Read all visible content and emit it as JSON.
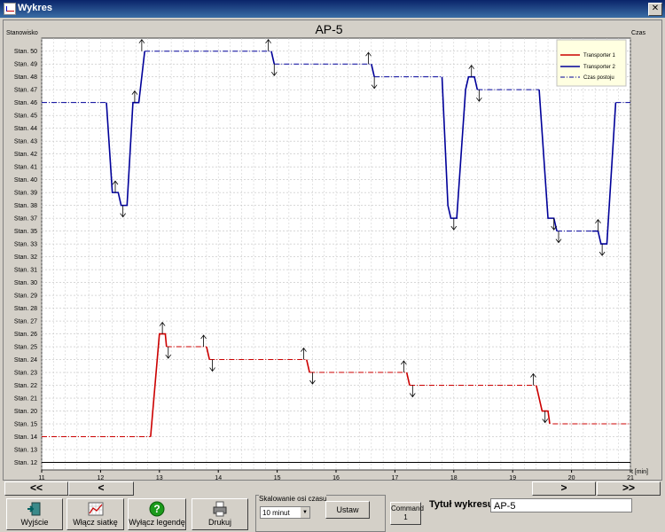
{
  "window": {
    "title": "Wykres"
  },
  "chart_data": {
    "type": "line",
    "title": "AP-5",
    "ylabel": "Stanowisko",
    "xlabel": "Czas",
    "x_unit": "t [min]",
    "xlim": [
      11,
      21
    ],
    "x_ticks": [
      "11",
      "12",
      "13",
      "14",
      "15",
      "16",
      "17",
      "18",
      "19",
      "20",
      "21"
    ],
    "y_categories": [
      "Stan. 12",
      "Stan. 13",
      "Stan. 14",
      "Stan. 15",
      "Stan. 20",
      "Stan. 21",
      "Stan. 22",
      "Stan. 23",
      "Stan. 24",
      "Stan. 25",
      "Stan. 26",
      "Stan. 27",
      "Stan. 28",
      "Stan. 29",
      "Stan. 30",
      "Stan. 31",
      "Stan. 32",
      "Stan. 33",
      "Stan. 35",
      "Stan. 37",
      "Stan. 38",
      "Stan. 39",
      "Stan. 40",
      "Stan. 41",
      "Stan. 42",
      "Stan. 43",
      "Stan. 44",
      "Stan. 45",
      "Stan. 46",
      "Stan. 47",
      "Stan. 48",
      "Stan. 49",
      "Stan. 50"
    ],
    "grid": true,
    "legend_position": "top-right",
    "legend": [
      {
        "label": "Transporter 1",
        "color": "#cc0000",
        "style": "solid"
      },
      {
        "label": "Transporter 2",
        "color": "#000099",
        "style": "solid"
      },
      {
        "label": "Czas postoju",
        "color": "#000099",
        "style": "dash-dot"
      }
    ],
    "series": [
      {
        "name": "Transporter 1",
        "color": "#cc0000",
        "segments": [
          {
            "kind": "idle",
            "points": [
              [
                11.0,
                "Stan. 14"
              ],
              [
                12.85,
                "Stan. 14"
              ]
            ]
          },
          {
            "kind": "move",
            "points": [
              [
                12.85,
                "Stan. 14"
              ],
              [
                13.0,
                "Stan. 26"
              ],
              [
                13.1,
                "Stan. 26"
              ],
              [
                13.12,
                "Stan. 25"
              ]
            ]
          },
          {
            "kind": "idle",
            "points": [
              [
                13.12,
                "Stan. 25"
              ],
              [
                13.8,
                "Stan. 25"
              ]
            ]
          },
          {
            "kind": "move",
            "points": [
              [
                13.8,
                "Stan. 25"
              ],
              [
                13.85,
                "Stan. 24"
              ]
            ]
          },
          {
            "kind": "idle",
            "points": [
              [
                13.85,
                "Stan. 24"
              ],
              [
                15.5,
                "Stan. 24"
              ]
            ]
          },
          {
            "kind": "move",
            "points": [
              [
                15.5,
                "Stan. 24"
              ],
              [
                15.55,
                "Stan. 23"
              ]
            ]
          },
          {
            "kind": "idle",
            "points": [
              [
                15.55,
                "Stan. 23"
              ],
              [
                17.2,
                "Stan. 23"
              ]
            ]
          },
          {
            "kind": "move",
            "points": [
              [
                17.2,
                "Stan. 23"
              ],
              [
                17.25,
                "Stan. 22"
              ]
            ]
          },
          {
            "kind": "idle",
            "points": [
              [
                17.25,
                "Stan. 22"
              ],
              [
                19.4,
                "Stan. 22"
              ]
            ]
          },
          {
            "kind": "move",
            "points": [
              [
                19.4,
                "Stan. 22"
              ],
              [
                19.5,
                "Stan. 20"
              ],
              [
                19.6,
                "Stan. 20"
              ],
              [
                19.63,
                "Stan. 15"
              ]
            ]
          },
          {
            "kind": "idle",
            "points": [
              [
                19.68,
                "Stan. 15"
              ],
              [
                21.0,
                "Stan. 15"
              ]
            ]
          }
        ],
        "markers": [
          {
            "x": 13.05,
            "y": "Stan. 26",
            "dir": "up"
          },
          {
            "x": 13.15,
            "y": "Stan. 25",
            "dir": "down"
          },
          {
            "x": 13.75,
            "y": "Stan. 25",
            "dir": "up"
          },
          {
            "x": 13.9,
            "y": "Stan. 24",
            "dir": "down"
          },
          {
            "x": 15.45,
            "y": "Stan. 24",
            "dir": "up"
          },
          {
            "x": 15.6,
            "y": "Stan. 23",
            "dir": "down"
          },
          {
            "x": 17.15,
            "y": "Stan. 23",
            "dir": "up"
          },
          {
            "x": 17.3,
            "y": "Stan. 22",
            "dir": "down"
          },
          {
            "x": 19.35,
            "y": "Stan. 22",
            "dir": "up"
          },
          {
            "x": 19.55,
            "y": "Stan. 20",
            "dir": "down"
          }
        ]
      },
      {
        "name": "Transporter 2",
        "color": "#000099",
        "segments": [
          {
            "kind": "idle",
            "points": [
              [
                11.0,
                "Stan. 46"
              ],
              [
                12.1,
                "Stan. 46"
              ]
            ]
          },
          {
            "kind": "move",
            "points": [
              [
                12.1,
                "Stan. 46"
              ],
              [
                12.2,
                "Stan. 39"
              ],
              [
                12.3,
                "Stan. 39"
              ],
              [
                12.35,
                "Stan. 38"
              ],
              [
                12.45,
                "Stan. 38"
              ],
              [
                12.55,
                "Stan. 46"
              ],
              [
                12.65,
                "Stan. 46"
              ],
              [
                12.75,
                "Stan. 50"
              ]
            ]
          },
          {
            "kind": "idle",
            "points": [
              [
                12.75,
                "Stan. 50"
              ],
              [
                14.9,
                "Stan. 50"
              ]
            ]
          },
          {
            "kind": "move",
            "points": [
              [
                14.9,
                "Stan. 50"
              ],
              [
                14.95,
                "Stan. 49"
              ]
            ]
          },
          {
            "kind": "idle",
            "points": [
              [
                14.95,
                "Stan. 49"
              ],
              [
                16.6,
                "Stan. 49"
              ]
            ]
          },
          {
            "kind": "move",
            "points": [
              [
                16.6,
                "Stan. 49"
              ],
              [
                16.65,
                "Stan. 48"
              ]
            ]
          },
          {
            "kind": "idle",
            "points": [
              [
                16.65,
                "Stan. 48"
              ],
              [
                17.8,
                "Stan. 48"
              ]
            ]
          },
          {
            "kind": "move",
            "points": [
              [
                17.8,
                "Stan. 48"
              ],
              [
                17.9,
                "Stan. 38"
              ],
              [
                17.95,
                "Stan. 37"
              ],
              [
                18.05,
                "Stan. 37"
              ],
              [
                18.2,
                "Stan. 47"
              ],
              [
                18.25,
                "Stan. 48"
              ],
              [
                18.35,
                "Stan. 48"
              ],
              [
                18.4,
                "Stan. 47"
              ]
            ]
          },
          {
            "kind": "idle",
            "points": [
              [
                18.4,
                "Stan. 47"
              ],
              [
                19.45,
                "Stan. 47"
              ]
            ]
          },
          {
            "kind": "move",
            "points": [
              [
                19.45,
                "Stan. 47"
              ],
              [
                19.6,
                "Stan. 37"
              ],
              [
                19.7,
                "Stan. 37"
              ],
              [
                19.75,
                "Stan. 35"
              ]
            ]
          },
          {
            "kind": "idle",
            "points": [
              [
                19.75,
                "Stan. 35"
              ],
              [
                20.35,
                "Stan. 35"
              ]
            ]
          },
          {
            "kind": "move",
            "points": [
              [
                20.35,
                "Stan. 35"
              ],
              [
                20.45,
                "Stan. 35"
              ],
              [
                20.5,
                "Stan. 33"
              ],
              [
                20.6,
                "Stan. 33"
              ],
              [
                20.75,
                "Stan. 46"
              ]
            ]
          },
          {
            "kind": "idle",
            "points": [
              [
                20.75,
                "Stan. 46"
              ],
              [
                21.0,
                "Stan. 46"
              ]
            ]
          }
        ],
        "markers": [
          {
            "x": 12.25,
            "y": "Stan. 39",
            "dir": "up"
          },
          {
            "x": 12.38,
            "y": "Stan. 38",
            "dir": "down"
          },
          {
            "x": 12.58,
            "y": "Stan. 46",
            "dir": "up"
          },
          {
            "x": 12.7,
            "y": "Stan. 50",
            "dir": "up"
          },
          {
            "x": 14.85,
            "y": "Stan. 50",
            "dir": "up"
          },
          {
            "x": 14.95,
            "y": "Stan. 49",
            "dir": "down"
          },
          {
            "x": 16.55,
            "y": "Stan. 49",
            "dir": "up"
          },
          {
            "x": 16.65,
            "y": "Stan. 48",
            "dir": "down"
          },
          {
            "x": 18.0,
            "y": "Stan. 37",
            "dir": "down"
          },
          {
            "x": 18.3,
            "y": "Stan. 48",
            "dir": "up"
          },
          {
            "x": 18.43,
            "y": "Stan. 47",
            "dir": "down"
          },
          {
            "x": 19.7,
            "y": "Stan. 37",
            "dir": "down"
          },
          {
            "x": 19.78,
            "y": "Stan. 35",
            "dir": "down"
          },
          {
            "x": 20.45,
            "y": "Stan. 35",
            "dir": "up"
          },
          {
            "x": 20.52,
            "y": "Stan. 33",
            "dir": "down"
          }
        ]
      }
    ]
  },
  "navigation": {
    "far_left": "<<",
    "left": "<",
    "right": ">",
    "far_right": ">>"
  },
  "toolbar": {
    "exit_label": "Wyjście",
    "grid_label": "Włącz siatkę",
    "legend_label": "Wyłącz legendę",
    "print_label": "Drukuj"
  },
  "scale": {
    "group_label": "Skalowanie osi czasu",
    "selected": "10 minut",
    "apply_label": "Ustaw"
  },
  "command": {
    "line1": "Command",
    "line2": "1"
  },
  "chart_title_field": {
    "label": "Tytuł wykresu:",
    "value": "AP-5"
  }
}
